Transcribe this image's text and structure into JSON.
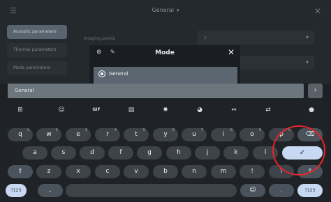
{
  "app": {
    "title": "General",
    "sidebar": [
      "Acoustic parameters",
      "Thermal parameters",
      "Mode parameters"
    ],
    "rows": [
      {
        "label": "Imaging points",
        "value": "1"
      },
      {
        "label": "",
        "value": ""
      }
    ]
  },
  "dialog": {
    "title": "Mode",
    "options": [
      "General"
    ]
  },
  "input": {
    "value": "General"
  },
  "keyboard": {
    "suggestions": {
      "gif": "GIF"
    },
    "row1": [
      {
        "k": "q",
        "h": "1"
      },
      {
        "k": "w",
        "h": "2"
      },
      {
        "k": "e",
        "h": "3"
      },
      {
        "k": "r",
        "h": "4"
      },
      {
        "k": "t",
        "h": "5"
      },
      {
        "k": "y",
        "h": "6"
      },
      {
        "k": "u",
        "h": "7"
      },
      {
        "k": "i",
        "h": "8"
      },
      {
        "k": "o",
        "h": "9"
      },
      {
        "k": "p",
        "h": "0"
      }
    ],
    "row2": [
      "a",
      "s",
      "d",
      "f",
      "g",
      "h",
      "j",
      "k",
      "l"
    ],
    "row3": [
      "z",
      "x",
      "c",
      "v",
      "b",
      "n",
      "m",
      "!",
      "?"
    ],
    "comma": ",",
    "period": ".",
    "numkey": "?123"
  }
}
